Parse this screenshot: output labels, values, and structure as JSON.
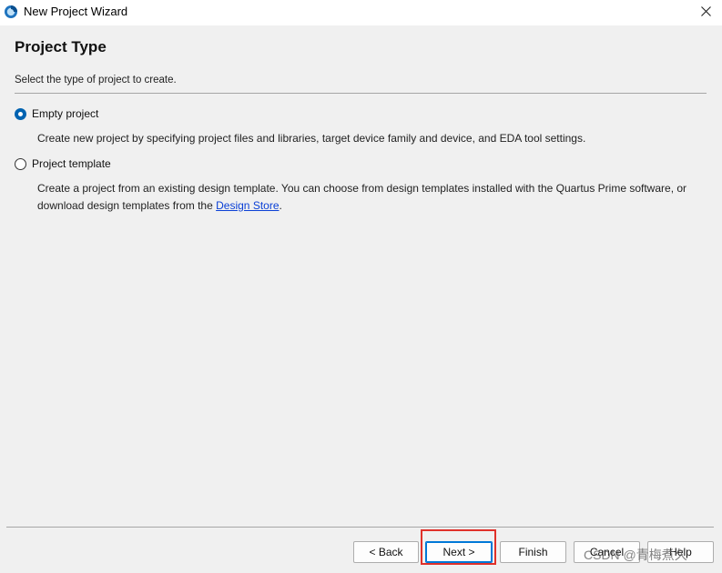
{
  "window": {
    "title": "New Project Wizard"
  },
  "page": {
    "heading": "Project Type",
    "subtitle": "Select the type of project to create."
  },
  "options": [
    {
      "label": "Empty project",
      "checked": true,
      "description": "Create new project by specifying project files and libraries, target device family and device, and EDA tool settings."
    },
    {
      "label": "Project template",
      "checked": false,
      "description_line1": "Create a project from an existing design template. You can choose from design templates installed with the Quartus Prime software, or",
      "description_prefix": "download design templates from the ",
      "link_text": "Design Store",
      "description_suffix": "."
    }
  ],
  "buttons": {
    "back": "< Back",
    "next": "Next >",
    "finish": "Finish",
    "cancel": "Cancel",
    "help": "Help"
  },
  "watermark": "CSDN @青梅煮久",
  "colors": {
    "accent": "#0078d7",
    "highlight": "#e0312a",
    "link": "#0b40d6"
  }
}
